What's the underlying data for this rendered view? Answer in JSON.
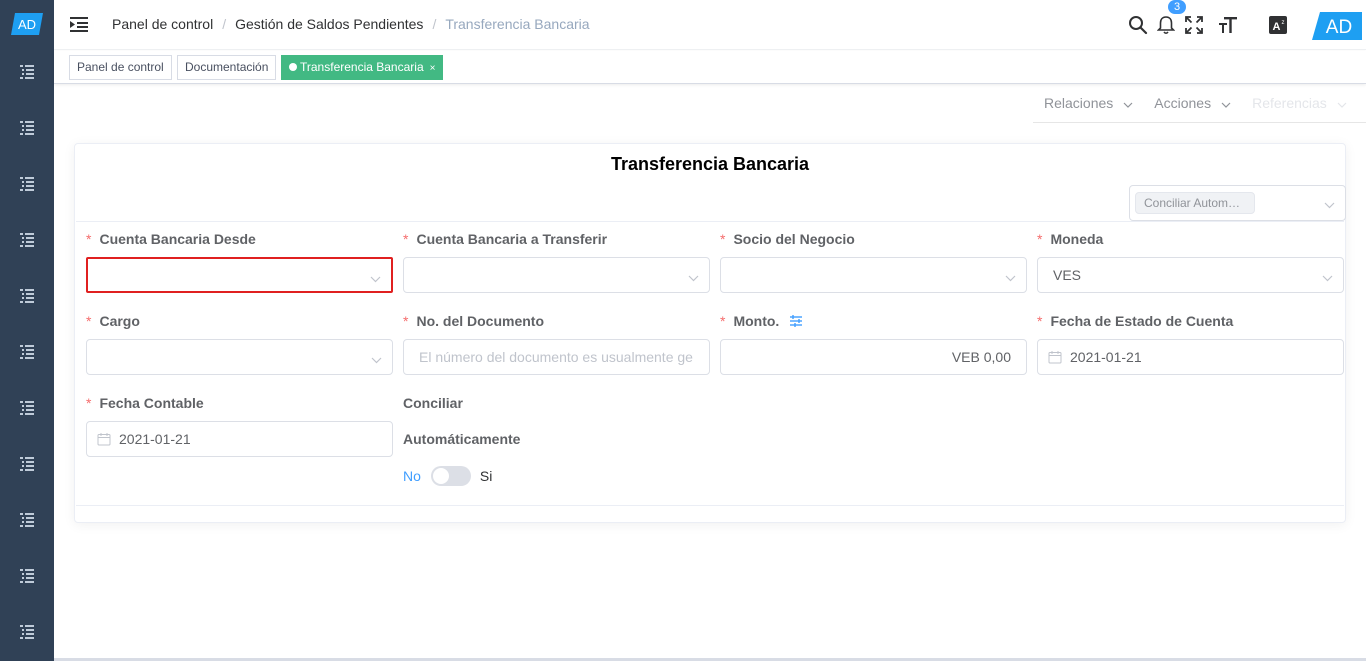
{
  "sidebar": {
    "logo_text": "AD",
    "item_count": 11
  },
  "header": {
    "breadcrumb": [
      "Panel de control",
      "Gestión de Saldos Pendientes",
      "Transferencia Bancaria"
    ],
    "notification_count": "3",
    "avatar_text": "AD"
  },
  "tags": {
    "items": [
      "Panel de control",
      "Documentación",
      "Transferencia Bancaria"
    ],
    "close_symbol": "×"
  },
  "action_menu": {
    "relations": "Relaciones",
    "actions": "Acciones",
    "references": "Referencias"
  },
  "form": {
    "title": "Transferencia Bancaria",
    "auto_reconcile_chip": "Conciliar Autom…",
    "fields": {
      "bank_from": {
        "label": "Cuenta Bancaria Desde",
        "value": ""
      },
      "bank_to": {
        "label": "Cuenta Bancaria a Transferir",
        "value": ""
      },
      "partner": {
        "label": "Socio del Negocio",
        "value": ""
      },
      "currency": {
        "label": "Moneda",
        "value": "VES"
      },
      "charge": {
        "label": "Cargo",
        "value": ""
      },
      "doc_no": {
        "label": "No. del Documento",
        "placeholder": "El número del documento es usualmente ge"
      },
      "amount": {
        "label": "Monto.",
        "value": "VEB 0,00"
      },
      "statement_date": {
        "label": "Fecha de Estado de Cuenta",
        "value": "2021-01-21"
      },
      "accounting_date": {
        "label": "Fecha Contable",
        "value": "2021-01-21"
      },
      "reconcile": {
        "label_line1": "Conciliar",
        "label_line2": "Automáticamente",
        "off": "No",
        "on": "Si"
      }
    },
    "required_mark": "*"
  },
  "colors": {
    "sidebar_bg": "#304156",
    "active_tag": "#42b983",
    "accent": "#409eff",
    "required": "#f56c6c",
    "error_border": "#e02020"
  }
}
